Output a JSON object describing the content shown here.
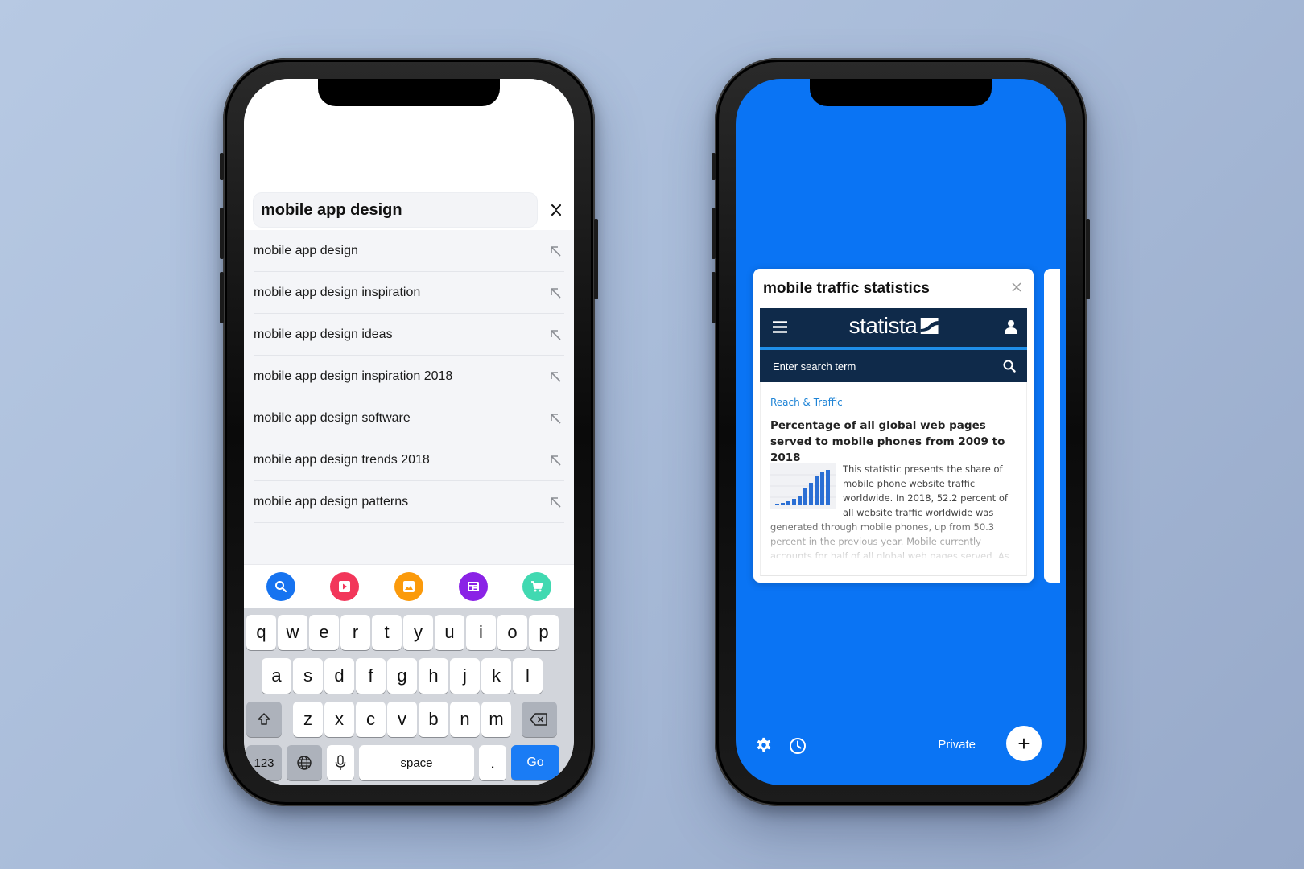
{
  "left_phone": {
    "search": {
      "query": "mobile app design"
    },
    "suggestions": [
      "mobile app design",
      "mobile app design inspiration",
      "mobile app design ideas",
      "mobile app design inspiration 2018",
      "mobile app design software",
      "mobile app design trends 2018",
      "mobile app design patterns"
    ],
    "quick_actions": [
      {
        "icon": "search-icon",
        "color": "#1673f0"
      },
      {
        "icon": "video-icon",
        "color": "#f2365a"
      },
      {
        "icon": "image-icon",
        "color": "#fb9a0b"
      },
      {
        "icon": "news-icon",
        "color": "#8a22e6"
      },
      {
        "icon": "shopping-cart-icon",
        "color": "#41d9b1"
      }
    ],
    "keyboard": {
      "row1": [
        "q",
        "w",
        "e",
        "r",
        "t",
        "y",
        "u",
        "i",
        "o",
        "p"
      ],
      "row2": [
        "a",
        "s",
        "d",
        "f",
        "g",
        "h",
        "j",
        "k",
        "l"
      ],
      "row3": [
        "z",
        "x",
        "c",
        "v",
        "b",
        "n",
        "m"
      ],
      "numbers_label": "123",
      "space_label": "space",
      "period_label": ".",
      "go_label": "Go"
    }
  },
  "right_phone": {
    "tab": {
      "title": "mobile traffic statistics",
      "site": {
        "logo": "statista",
        "search_placeholder": "Enter search term",
        "category": "Reach & Traffic",
        "headline": "Percentage of all global web pages served to mobile phones from 2009 to 2018",
        "description": "This statistic presents the share of mobile phone website traffic worldwide. In 2018, 52.2 percent of all website traffic worldwide was generated through mobile phones, up from 50.3 percent in the previous year. Mobile currently accounts for half of all global web pages served. As of"
      }
    },
    "bottom_bar": {
      "private_label": "Private",
      "add_label": "+"
    },
    "accent_color": "#0a74f4"
  }
}
